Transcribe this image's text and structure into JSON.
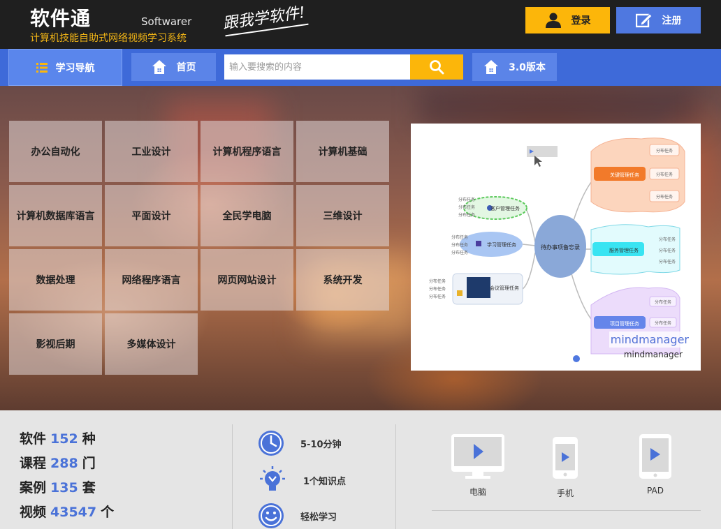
{
  "header": {
    "logo": "软件通",
    "logo_en": "Softwarer",
    "tagline": "计算机技能自助式网络视频学习系统",
    "slogan": "跟我学软件!",
    "login_label": "登录",
    "register_label": "注册"
  },
  "nav": {
    "guide_label": "学习导航",
    "home_label": "首页",
    "search_placeholder": "输入要搜索的内容",
    "version_label": "3.0版本"
  },
  "categories": [
    "办公自动化",
    "工业设计",
    "计算机程序语言",
    "计算机基础",
    "计算机数据库语言",
    "平面设计",
    "全民学电脑",
    "三维设计",
    "数据处理",
    "网络程序语言",
    "网页网站设计",
    "系统开发",
    "影视后期",
    "多媒体设计"
  ],
  "banner": {
    "caption": "mindmanager",
    "subcaption": "mindmanager",
    "center_node": "待办事项备忘录",
    "left_nodes": [
      "客户管理任务",
      "学习管理任务",
      "会议管理任务"
    ],
    "right_nodes": [
      "关键管理任务",
      "服务管理任务",
      "项目管理任务"
    ],
    "leaf_label": "分布任务"
  },
  "stats": {
    "items": [
      {
        "label": "软件",
        "value": "152",
        "unit": "种"
      },
      {
        "label": "课程",
        "value": "288",
        "unit": "门"
      },
      {
        "label": "案例",
        "value": "135",
        "unit": "套"
      },
      {
        "label": "视频",
        "value": "43547",
        "unit": "个"
      }
    ],
    "features": [
      "5-10分钟",
      "1个知识点",
      "轻松学习"
    ],
    "devices": [
      "电脑",
      "手机",
      "PAD"
    ]
  },
  "colors": {
    "accent_blue": "#4f78e0",
    "accent_yellow": "#fcb60a",
    "header_bg": "#1f1f1f"
  }
}
